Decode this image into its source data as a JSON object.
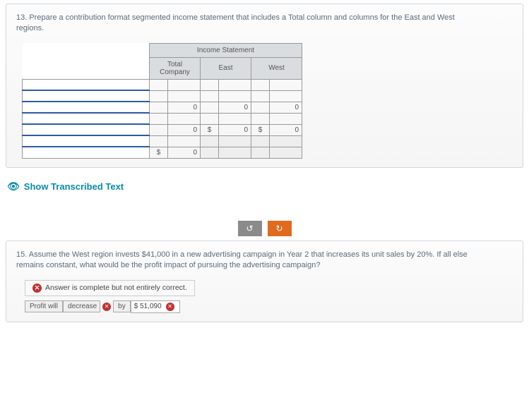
{
  "q13": {
    "prompt": "13. Prepare a contribution format segmented income statement that includes a Total column and columns for the East and West regions.",
    "table_title": "Income Statement",
    "col_total": "Total Company",
    "col_east": "East",
    "col_west": "West",
    "zero": "0",
    "dollar": "$"
  },
  "show_transcribed": "Show Transcribed Text",
  "nav": {
    "prev_icon": "↺",
    "next_icon": "↻"
  },
  "q15": {
    "prompt": "15. Assume the West region invests $41,000 in a new advertising campaign in Year 2 that increases its unit sales by 20%. If all else remains constant, what would be the profit impact of pursuing the advertising campaign?",
    "feedback": "Answer is complete but not entirely correct.",
    "profit_will": "Profit will",
    "decrease": "decrease",
    "by": "by",
    "amount": "$ 51,090"
  }
}
